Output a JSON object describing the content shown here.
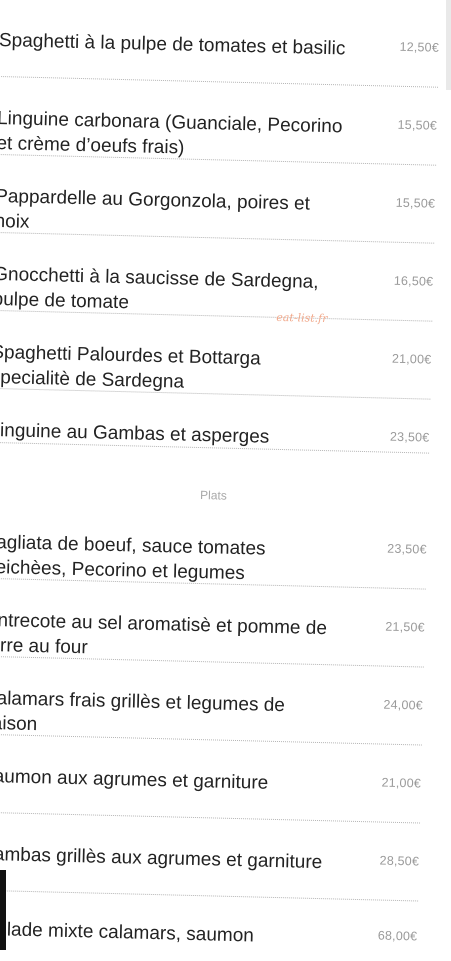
{
  "pasta_items": [
    {
      "name": "Spaghetti à la pulpe de tomates et basilic",
      "price": "12,50€"
    },
    {
      "name": "Linguine carbonara (Guanciale, Pecorino et crème d’oeufs frais)",
      "price": "15,50€"
    },
    {
      "name": "Pappardelle au Gorgonzola, poires et noix",
      "price": "15,50€"
    },
    {
      "name": "Gnocchetti à la saucisse de Sardegna, pulpe de tomate",
      "price": "16,50€"
    },
    {
      "name": "Spaghetti Palourdes et Bottarga specialitè de Sardegna",
      "price": "21,00€"
    },
    {
      "name": "Linguine au Gambas et asperges",
      "price": "23,50€"
    }
  ],
  "section_plats": "Plats",
  "plats_items": [
    {
      "name": "Tagliata de boeuf, sauce tomates seichèes, Pecorino et legumes",
      "price": "23,50€"
    },
    {
      "name": "Entrecote au sel aromatisè et pomme de terre au four",
      "price": "21,50€"
    },
    {
      "name": "Calamars frais grillès et legumes de saison",
      "price": "24,00€"
    },
    {
      "name": "Saumon aux agrumes et garniture",
      "price": "21,00€"
    },
    {
      "name": "Gambas grillès aux agrumes et garniture",
      "price": "28,50€"
    },
    {
      "name": "Grillade mixte calamars, saumon",
      "price": "68,00€"
    }
  ],
  "watermark": "eat-list.fr"
}
